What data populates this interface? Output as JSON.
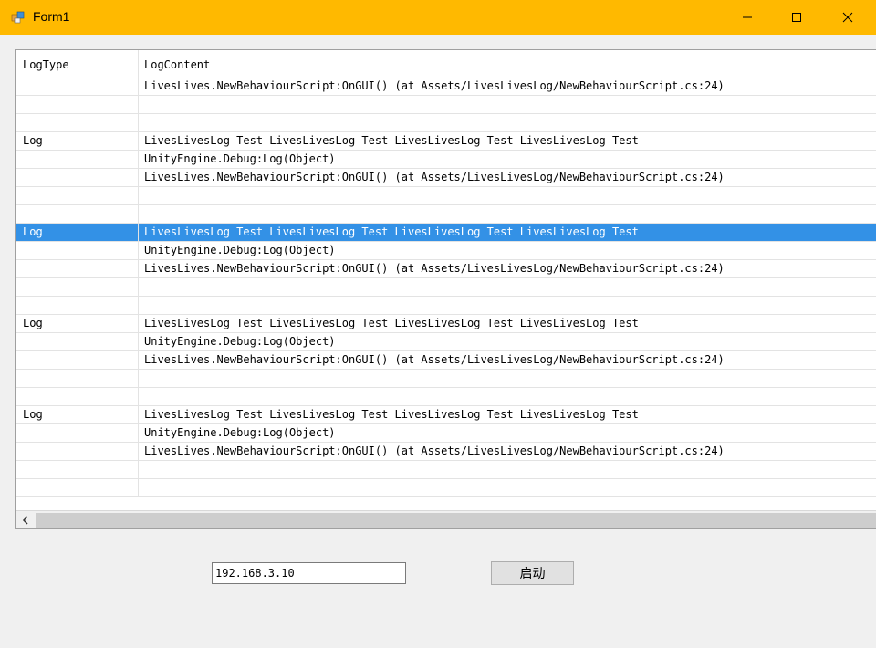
{
  "window": {
    "title": "Form1"
  },
  "grid": {
    "headers": {
      "log_type": "LogType",
      "log_content": "LogContent"
    },
    "rows": [
      {
        "type": "",
        "content": "LivesLives.NewBehaviourScript:OnGUI() (at Assets/LivesLivesLog/NewBehaviourScript.cs:24)",
        "selected": false
      },
      {
        "type": "",
        "content": "",
        "selected": false
      },
      {
        "type": "",
        "content": "",
        "selected": false
      },
      {
        "type": "Log",
        "content": "LivesLivesLog Test LivesLivesLog Test LivesLivesLog Test LivesLivesLog Test",
        "selected": false
      },
      {
        "type": "",
        "content": "UnityEngine.Debug:Log(Object)",
        "selected": false
      },
      {
        "type": "",
        "content": "LivesLives.NewBehaviourScript:OnGUI() (at Assets/LivesLivesLog/NewBehaviourScript.cs:24)",
        "selected": false
      },
      {
        "type": "",
        "content": "",
        "selected": false
      },
      {
        "type": "",
        "content": "",
        "selected": false
      },
      {
        "type": "Log",
        "content": "LivesLivesLog Test LivesLivesLog Test LivesLivesLog Test LivesLivesLog Test",
        "selected": true
      },
      {
        "type": "",
        "content": "UnityEngine.Debug:Log(Object)",
        "selected": false
      },
      {
        "type": "",
        "content": "LivesLives.NewBehaviourScript:OnGUI() (at Assets/LivesLivesLog/NewBehaviourScript.cs:24)",
        "selected": false
      },
      {
        "type": "",
        "content": "",
        "selected": false
      },
      {
        "type": "",
        "content": "",
        "selected": false
      },
      {
        "type": "Log",
        "content": "LivesLivesLog Test LivesLivesLog Test LivesLivesLog Test LivesLivesLog Test",
        "selected": false
      },
      {
        "type": "",
        "content": "UnityEngine.Debug:Log(Object)",
        "selected": false
      },
      {
        "type": "",
        "content": "LivesLives.NewBehaviourScript:OnGUI() (at Assets/LivesLivesLog/NewBehaviourScript.cs:24)",
        "selected": false
      },
      {
        "type": "",
        "content": "",
        "selected": false
      },
      {
        "type": "",
        "content": "",
        "selected": false
      },
      {
        "type": "Log",
        "content": "LivesLivesLog Test LivesLivesLog Test LivesLivesLog Test LivesLivesLog Test",
        "selected": false
      },
      {
        "type": "",
        "content": "UnityEngine.Debug:Log(Object)",
        "selected": false
      },
      {
        "type": "",
        "content": "LivesLives.NewBehaviourScript:OnGUI() (at Assets/LivesLivesLog/NewBehaviourScript.cs:24)",
        "selected": false
      },
      {
        "type": "",
        "content": "",
        "selected": false
      },
      {
        "type": "",
        "content": "",
        "selected": false
      }
    ]
  },
  "controls": {
    "ip_value": "192.168.3.10",
    "start_label": "启动"
  },
  "colors": {
    "titlebar": "#ffb900",
    "selection": "#3391e6"
  },
  "icons": [
    "app-icon",
    "minimize-icon",
    "maximize-icon",
    "close-icon",
    "scroll-left-icon"
  ]
}
